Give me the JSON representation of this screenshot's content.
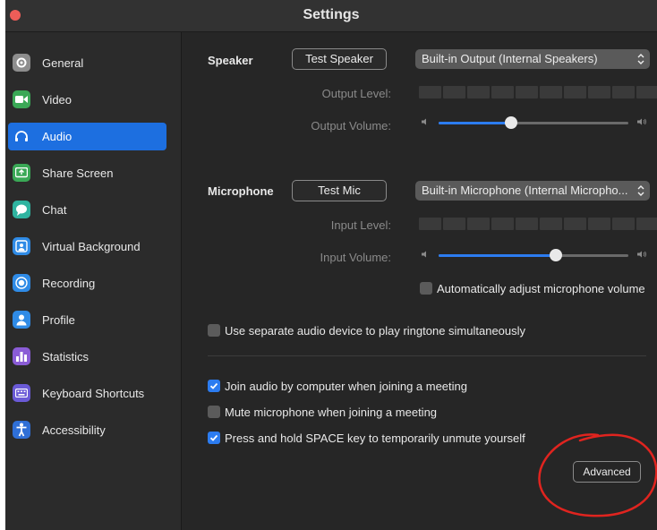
{
  "window": {
    "title": "Settings"
  },
  "sidebar": {
    "items": [
      {
        "label": "General",
        "icon": "gear-icon",
        "color": "#8d8d8d",
        "active": false
      },
      {
        "label": "Video",
        "icon": "video-camera-icon",
        "color": "#3aa856",
        "active": false
      },
      {
        "label": "Audio",
        "icon": "headphones-icon",
        "color": "#1d6fe0",
        "active": true
      },
      {
        "label": "Share Screen",
        "icon": "share-screen-icon",
        "color": "#3aa856",
        "active": false
      },
      {
        "label": "Chat",
        "icon": "chat-bubble-icon",
        "color": "#2fb3a0",
        "active": false
      },
      {
        "label": "Virtual Background",
        "icon": "person-background-icon",
        "color": "#2f8be6",
        "active": false
      },
      {
        "label": "Recording",
        "icon": "record-icon",
        "color": "#2f8be6",
        "active": false
      },
      {
        "label": "Profile",
        "icon": "profile-icon",
        "color": "#2f8be6",
        "active": false
      },
      {
        "label": "Statistics",
        "icon": "bar-chart-icon",
        "color": "#8a5cd6",
        "active": false
      },
      {
        "label": "Keyboard Shortcuts",
        "icon": "keyboard-icon",
        "color": "#6a5ad6",
        "active": false
      },
      {
        "label": "Accessibility",
        "icon": "accessibility-icon",
        "color": "#2f6fd6",
        "active": false
      }
    ]
  },
  "speaker": {
    "label": "Speaker",
    "test_button": "Test Speaker",
    "device": "Built-in Output (Internal Speakers)",
    "output_level_label": "Output Level:",
    "output_volume_label": "Output Volume:",
    "volume_fraction": 0.38
  },
  "microphone": {
    "label": "Microphone",
    "test_button": "Test Mic",
    "device": "Built-in Microphone (Internal Micropho...",
    "input_level_label": "Input Level:",
    "input_volume_label": "Input Volume:",
    "volume_fraction": 0.62,
    "auto_adjust_label": "Automatically adjust microphone volume",
    "auto_adjust_checked": false
  },
  "ringtone": {
    "label": "Use separate audio device to play ringtone simultaneously",
    "checked": false
  },
  "options": [
    {
      "label": "Join audio by computer when joining a meeting",
      "checked": true
    },
    {
      "label": "Mute microphone when joining a meeting",
      "checked": false
    },
    {
      "label": "Press and hold SPACE key to temporarily unmute yourself",
      "checked": true
    }
  ],
  "advanced_button": "Advanced",
  "colors": {
    "accent": "#2c7cf0",
    "active_sidebar": "#1d6fe0",
    "annotation": "#e0241f"
  }
}
